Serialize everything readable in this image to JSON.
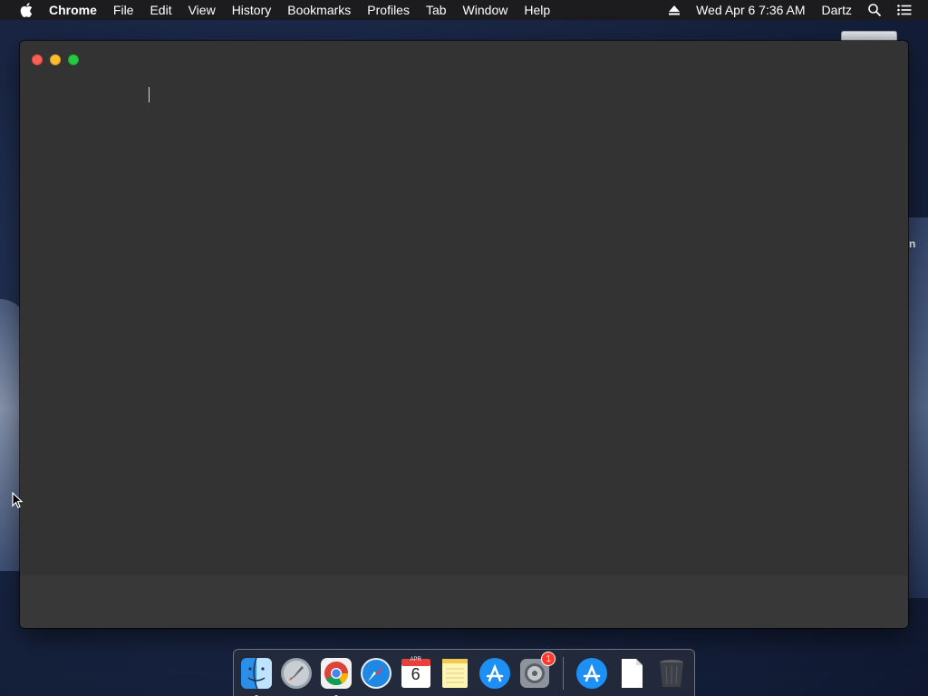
{
  "menubar": {
    "app_name": "Chrome",
    "items": [
      "File",
      "Edit",
      "View",
      "History",
      "Bookmarks",
      "Profiles",
      "Tab",
      "Window",
      "Help"
    ],
    "datetime": "Wed Apr 6  7:36 AM",
    "user": "Dartz"
  },
  "desktop": {
    "partial_label": "n"
  },
  "dock": {
    "apps": [
      {
        "name": "Finder",
        "icon": "finder-icon",
        "running": true
      },
      {
        "name": "Launchpad",
        "icon": "launchpad-icon",
        "running": false
      },
      {
        "name": "Chrome",
        "icon": "chrome-icon",
        "running": true
      },
      {
        "name": "Safari",
        "icon": "safari-icon",
        "running": false
      },
      {
        "name": "Calendar",
        "icon": "calendar-icon",
        "month": "APR",
        "date": "6"
      },
      {
        "name": "Notes",
        "icon": "notes-icon"
      },
      {
        "name": "App Store",
        "icon": "app-store-icon"
      },
      {
        "name": "System Preferences",
        "icon": "system-preferences-icon",
        "badge": "1"
      }
    ],
    "right_items": [
      {
        "name": "App Store",
        "icon": "app-store-icon"
      },
      {
        "name": "Document",
        "icon": "document-icon"
      },
      {
        "name": "Trash",
        "icon": "trash-icon"
      }
    ]
  },
  "colors": {
    "menubar": "#1c1c1e",
    "window_bg": "#333333",
    "close": "#ff5f57",
    "minimize": "#febc2e",
    "maximize": "#28c840"
  }
}
